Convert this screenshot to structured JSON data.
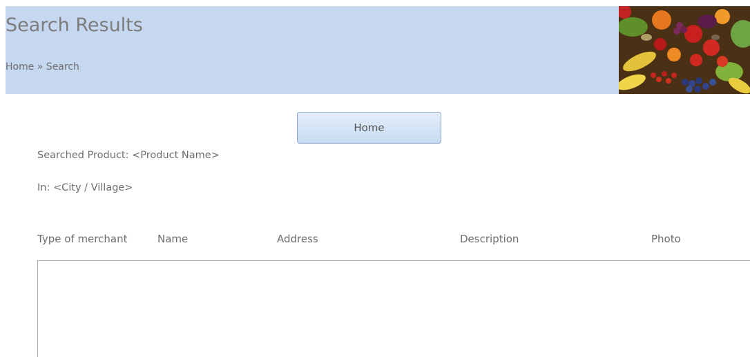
{
  "header": {
    "title": "Search Results",
    "breadcrumb": "Home » Search",
    "banner_image": "vegetables-photo"
  },
  "toolbar": {
    "home_label": "Home"
  },
  "search": {
    "product_line": "Searched Product: <Product Name>",
    "location_line": "In: <City / Village>"
  },
  "table": {
    "columns": [
      "Type of merchant",
      "Name",
      "Address",
      "Description",
      "Photo"
    ],
    "rows": []
  },
  "colors": {
    "header_background": "#c6d8f0",
    "button_border": "#8ea9cc",
    "text": "#6d6d6d"
  }
}
